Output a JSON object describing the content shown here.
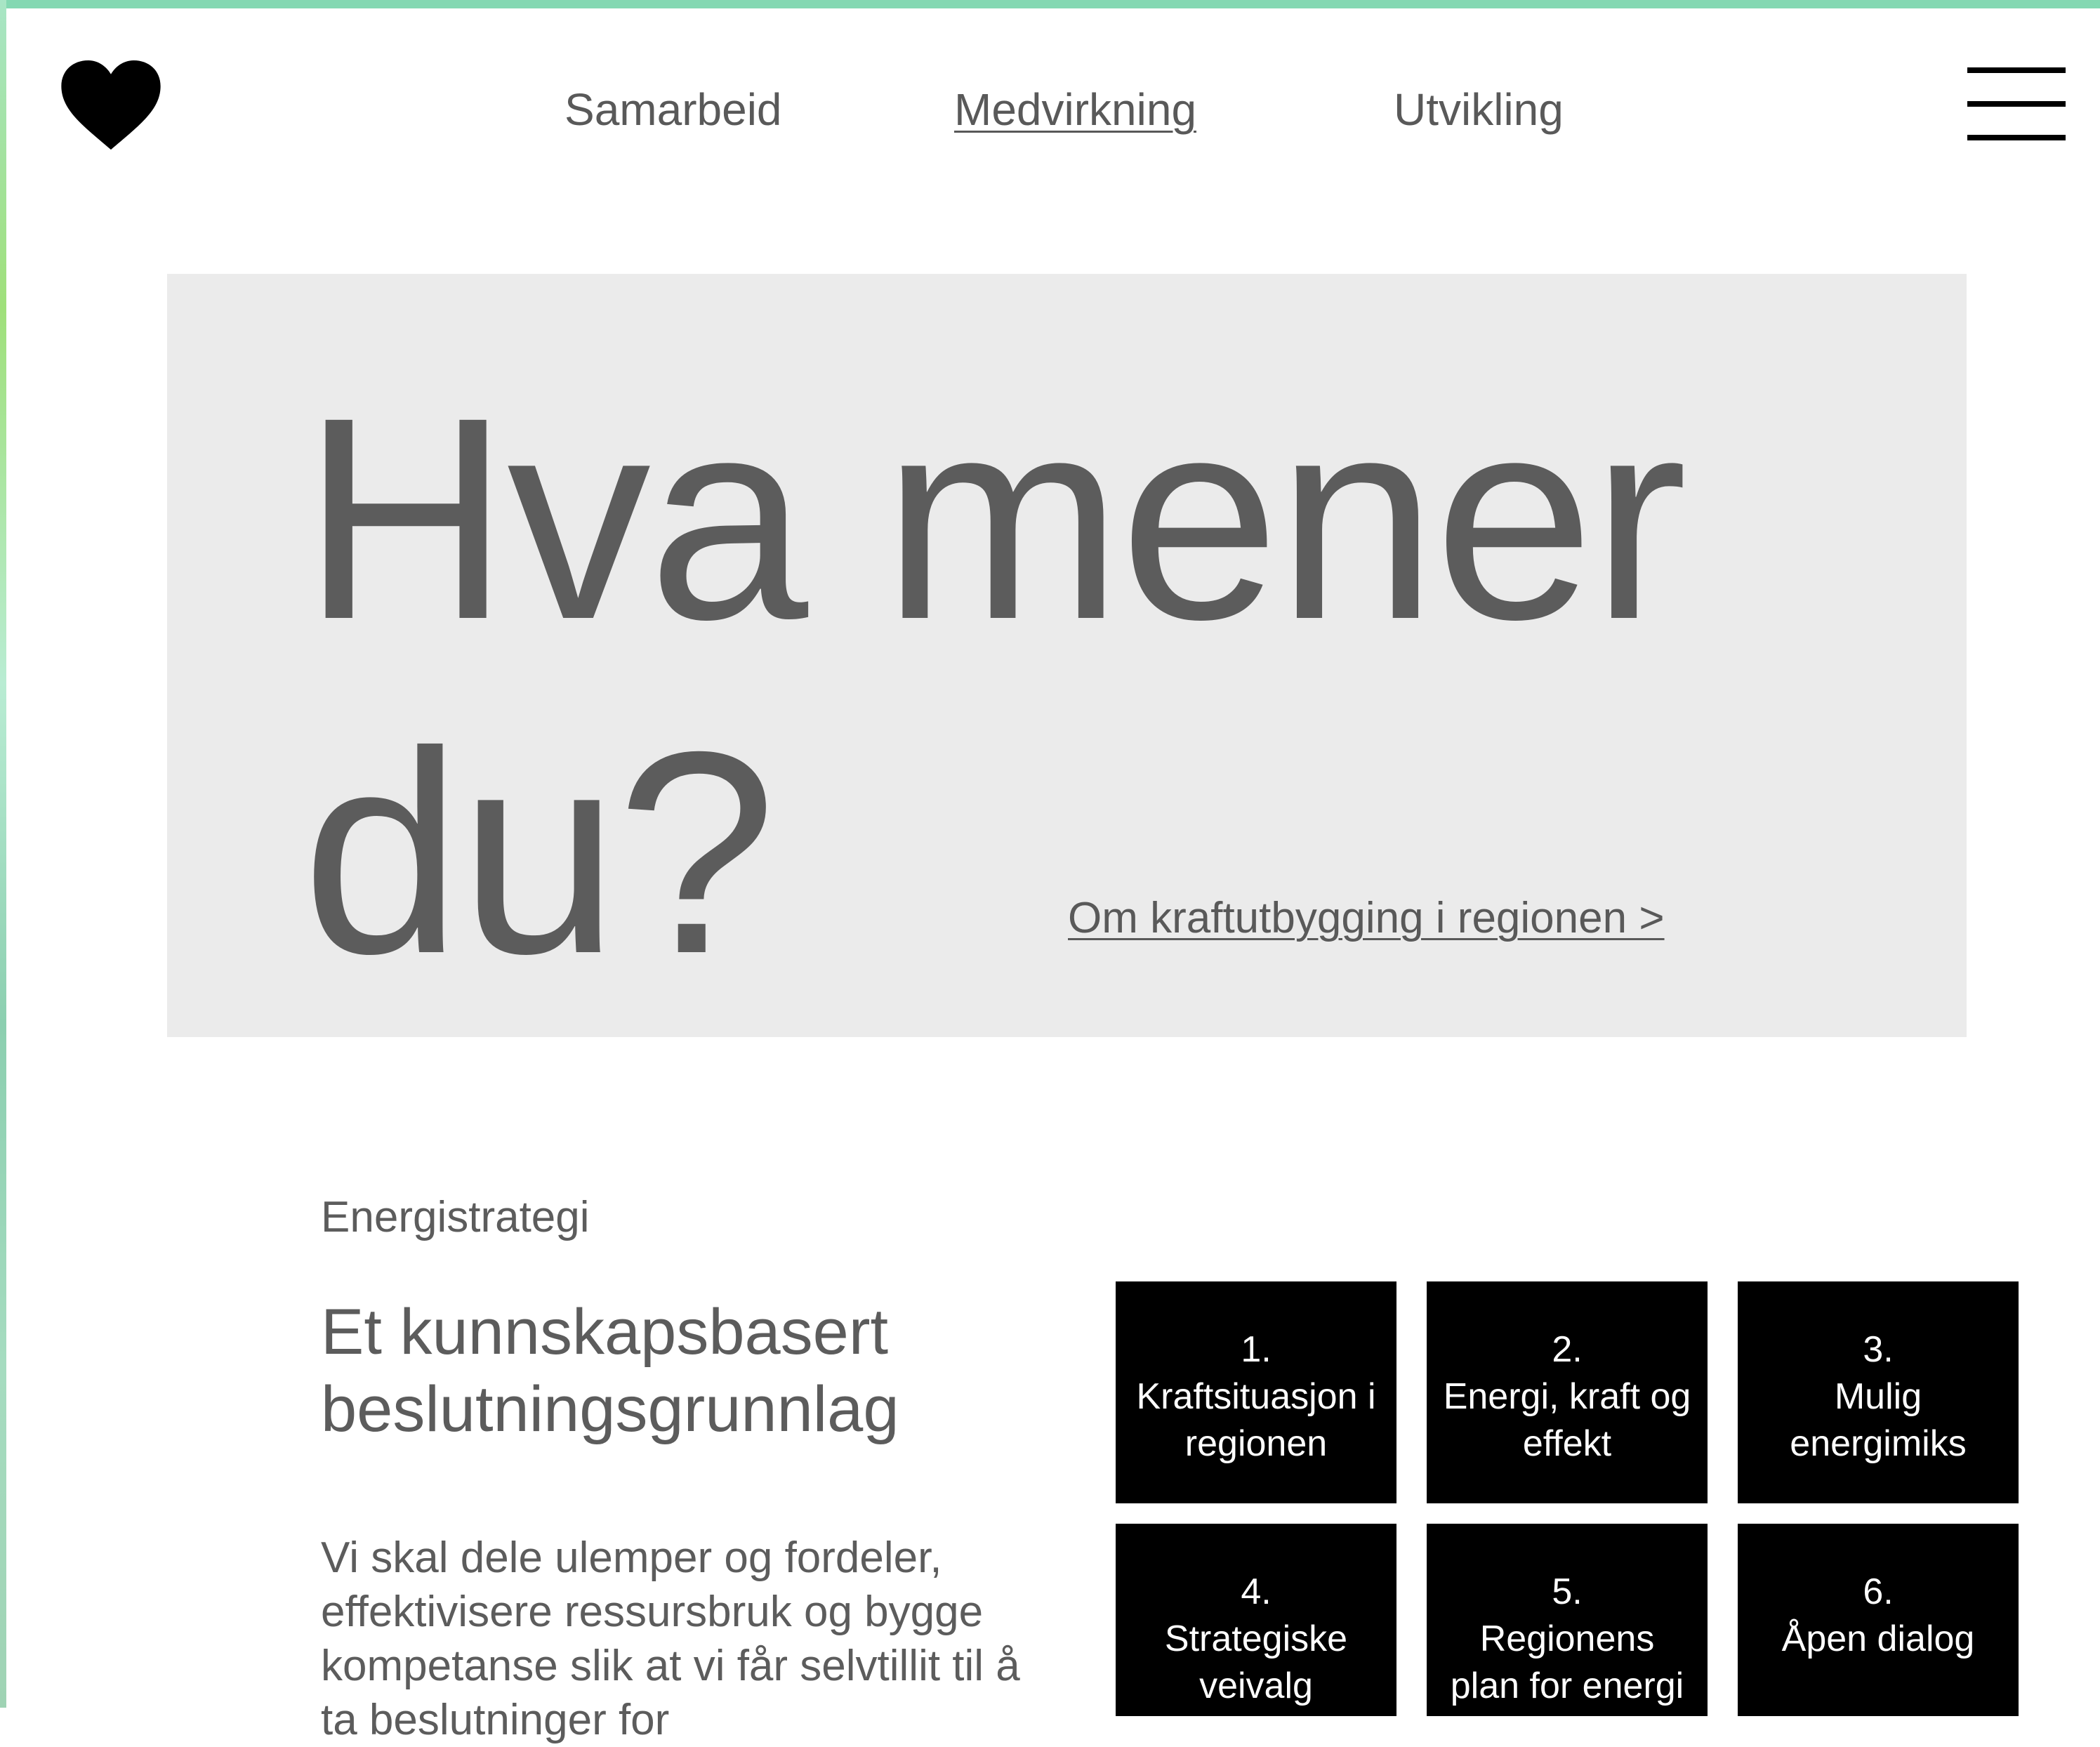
{
  "header": {
    "nav": [
      {
        "label": "Samarbeid"
      },
      {
        "label": "Medvirkning",
        "active": true
      },
      {
        "label": "Utvikling"
      }
    ]
  },
  "hero": {
    "title": "Hva mener du?",
    "link": "Om kraftutbygging i regionen >"
  },
  "section": {
    "eyebrow": "Energistrategi",
    "title": "Et kunnskapsbasert beslutningsgrunnlag",
    "body": "Vi skal dele ulemper og fordeler, effektivisere ressursbruk og bygge kompetanse slik at vi får selvtillit til å ta beslutninger for"
  },
  "tiles": [
    {
      "num": "1.",
      "label": "Kraftsituasjon i regionen"
    },
    {
      "num": "2.",
      "label": "Energi, kraft og effekt"
    },
    {
      "num": "3.",
      "label": "Mulig energimiks"
    },
    {
      "num": "4.",
      "label": "Strategiske veivalg"
    },
    {
      "num": "5.",
      "label": "Regionens plan for energi"
    },
    {
      "num": "6.",
      "label": "Åpen dialog"
    }
  ],
  "colors": {
    "accent_strip": "#84d8b2",
    "hero_bg": "#ebebeb",
    "text": "#5c5c5c",
    "tile_bg": "#000000",
    "tile_text": "#ffffff"
  }
}
